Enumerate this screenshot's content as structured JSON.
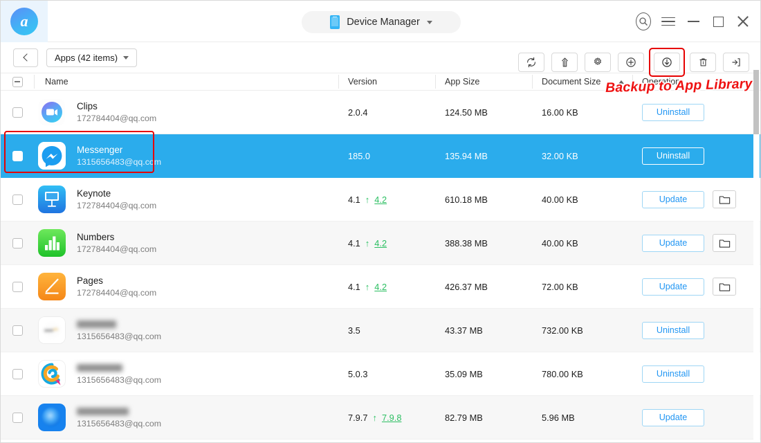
{
  "window": {
    "logo_letter": "a",
    "device_title": "Device Manager",
    "controls": {
      "search": "search-icon",
      "menu": "menu-icon",
      "minimize": "minimize-icon",
      "maximize": "maximize-icon",
      "close": "close-icon"
    }
  },
  "toolbar": {
    "back_label": "",
    "apps_label": "Apps (42 items)",
    "buttons": [
      {
        "name": "refresh",
        "label": "Refresh"
      },
      {
        "name": "upload",
        "label": "Install / Import"
      },
      {
        "name": "settings",
        "label": "Settings"
      },
      {
        "name": "add",
        "label": "Add"
      },
      {
        "name": "backup-to-app-library",
        "label": "Backup to App Library"
      },
      {
        "name": "delete",
        "label": "Delete"
      },
      {
        "name": "export",
        "label": "Export"
      }
    ]
  },
  "annotation": {
    "text": "Backup to App Library",
    "color": "#ee1111"
  },
  "table": {
    "headers": {
      "name": "Name",
      "version": "Version",
      "app_size": "App Size",
      "document_size": "Document Size",
      "operation": "Operation"
    },
    "sort_column": "Document Size",
    "sort_direction": "asc",
    "select_all_state": "indeterminate",
    "rows": [
      {
        "name": "Clips",
        "account": "172784404@qq.com",
        "name_blurred": false,
        "version": "2.0.4",
        "new_version": "",
        "app_size": "124.50 MB",
        "document_size": "16.00 KB",
        "operation": "Uninstall",
        "has_folder": false,
        "checked": false,
        "selected": false,
        "icon": "clips-icon"
      },
      {
        "name": "Messenger",
        "account": "1315656483@qq.com",
        "name_blurred": false,
        "version": "185.0",
        "new_version": "",
        "app_size": "135.94 MB",
        "document_size": "32.00 KB",
        "operation": "Uninstall",
        "has_folder": false,
        "checked": true,
        "selected": true,
        "icon": "messenger-icon"
      },
      {
        "name": "Keynote",
        "account": "172784404@qq.com",
        "name_blurred": false,
        "version": "4.1",
        "new_version": "4.2",
        "app_size": "610.18 MB",
        "document_size": "40.00 KB",
        "operation": "Update",
        "has_folder": true,
        "checked": false,
        "selected": false,
        "icon": "keynote-icon"
      },
      {
        "name": "Numbers",
        "account": "172784404@qq.com",
        "name_blurred": false,
        "version": "4.1",
        "new_version": "4.2",
        "app_size": "388.38 MB",
        "document_size": "40.00 KB",
        "operation": "Update",
        "has_folder": true,
        "checked": false,
        "selected": false,
        "icon": "numbers-icon"
      },
      {
        "name": "Pages",
        "account": "172784404@qq.com",
        "name_blurred": false,
        "version": "4.1",
        "new_version": "4.2",
        "app_size": "426.37 MB",
        "document_size": "72.00 KB",
        "operation": "Update",
        "has_folder": true,
        "checked": false,
        "selected": false,
        "icon": "pages-icon"
      },
      {
        "name": "",
        "account": "1315656483@qq.com",
        "name_blurred": true,
        "version": "3.5",
        "new_version": "",
        "app_size": "43.37 MB",
        "document_size": "732.00 KB",
        "operation": "Uninstall",
        "has_folder": false,
        "checked": false,
        "selected": false,
        "icon": "blurred-white-icon"
      },
      {
        "name": "",
        "account": "1315656483@qq.com",
        "name_blurred": true,
        "version": "5.0.3",
        "new_version": "",
        "app_size": "35.09 MB",
        "document_size": "780.00 KB",
        "operation": "Uninstall",
        "has_folder": false,
        "checked": false,
        "selected": false,
        "icon": "spiral-icon"
      },
      {
        "name": "",
        "account": "1315656483@qq.com",
        "name_blurred": true,
        "version": "7.9.7",
        "new_version": "7.9.8",
        "app_size": "82.79 MB",
        "document_size": "5.96 MB",
        "operation": "Update",
        "has_folder": false,
        "checked": false,
        "selected": false,
        "icon": "blue-glow-icon"
      }
    ]
  },
  "colors": {
    "selection_blue": "#2bacec",
    "annotation_red": "#ee1111",
    "highlight_red": "#e60000",
    "update_green": "#2cbf62",
    "link_blue": "#2196f3"
  }
}
